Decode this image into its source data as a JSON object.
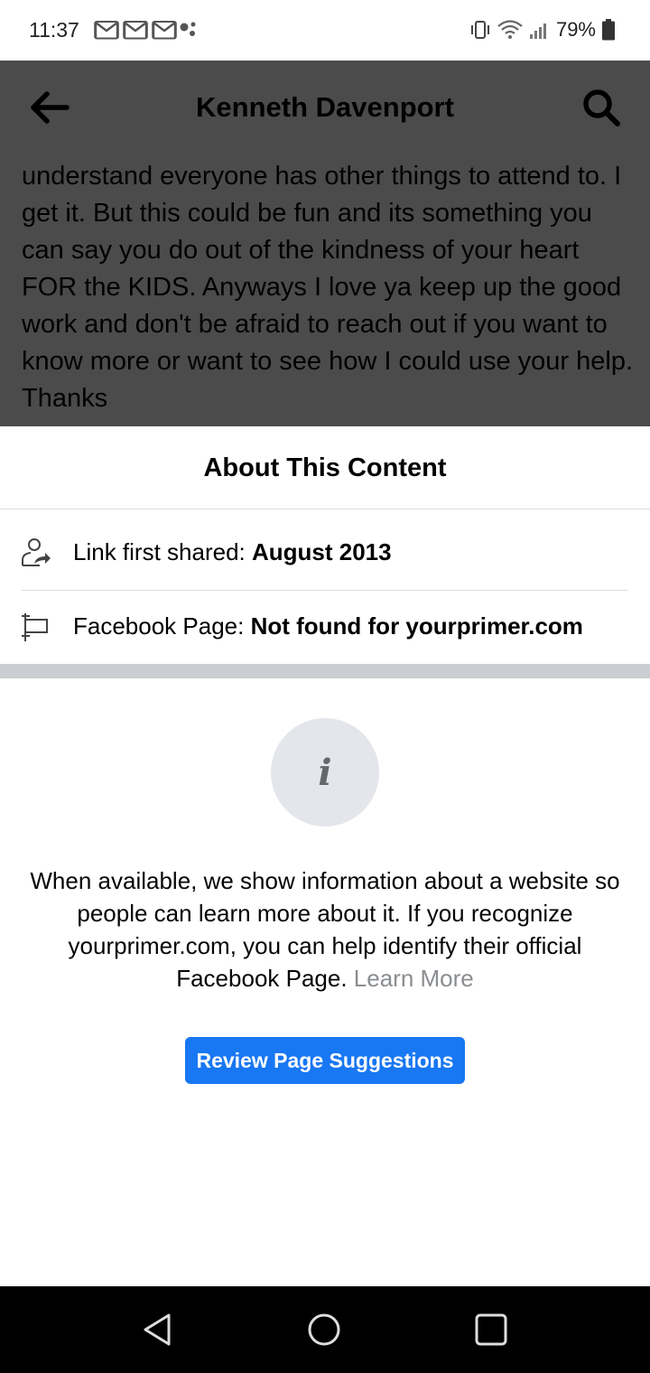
{
  "status_bar": {
    "time": "11:37",
    "battery": "79%",
    "icons": [
      "gmail-icon",
      "gmail-icon",
      "gmail-icon",
      "assistant-dots-icon",
      "vibrate-icon",
      "wifi-icon",
      "signal-icon",
      "battery-icon"
    ]
  },
  "header": {
    "title": "Kenneth Davenport",
    "back_icon": "arrow-left-icon",
    "search_icon": "search-icon"
  },
  "post": {
    "text": "understand everyone has other things to attend to. I get it. But this could be fun and its something you can say you do out of the kindness of your heart FOR the KIDS. Anyways I love ya keep up the good work and don't be afraid to reach out if you want to know more or want to see how I could use your help. Thanks"
  },
  "sheet": {
    "title": "About This Content",
    "rows": [
      {
        "icon": "person-share-icon",
        "label": "Link first shared: ",
        "value": "August 2013"
      },
      {
        "icon": "flag-icon",
        "label": "Facebook Page: ",
        "value": "Not found for yourprimer.com"
      }
    ],
    "info_icon": "info-icon",
    "info_glyph": "i",
    "explanation": "When available, we show information about a website so people can learn more about it. If you recognize yourprimer.com, you can help identify their official Facebook Page. ",
    "learn_more": "Learn More",
    "button_label": "Review Page Suggestions"
  },
  "colors": {
    "dim_overlay": "#4b4b4b",
    "primary_button": "#1877f2",
    "link_gray": "#8a8d91",
    "divider": "#dadde1"
  },
  "nav_bar": {
    "icons": [
      "back-triangle-icon",
      "home-circle-icon",
      "recents-square-icon"
    ]
  }
}
